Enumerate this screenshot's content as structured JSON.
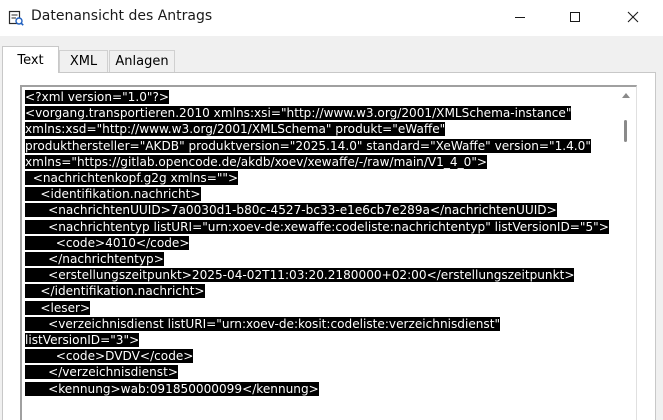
{
  "window": {
    "title": "Datenansicht des Antrags",
    "icon": "document-view-icon"
  },
  "tabs": [
    {
      "label": "Text",
      "active": true
    },
    {
      "label": "XML",
      "active": false
    },
    {
      "label": "Anlagen",
      "active": false
    }
  ],
  "content": {
    "lines": [
      "<?xml version=\"1.0\"?>",
      "<vorgang.transportieren.2010 xmlns:xsi=\"http://www.w3.org/2001/XMLSchema-instance\"",
      "xmlns:xsd=\"http://www.w3.org/2001/XMLSchema\" produkt=\"eWaffe\"",
      "produkthersteller=\"AKDB\" produktversion=\"2025.14.0\" standard=\"XeWaffe\" version=\"1.4.0\"",
      "xmlns=\"https://gitlab.opencode.de/akdb/xoev/xewaffe/-/raw/main/V1_4_0\">",
      "  <nachrichtenkopf.g2g xmlns=\"\">",
      "    <identifikation.nachricht>",
      "      <nachrichtenUUID>7a0030d1-b80c-4527-bc33-e1e6cb7e289a</nachrichtenUUID>",
      "      <nachrichtentyp listURI=\"urn:xoev-de:xewaffe:codeliste:nachrichtentyp\" listVersionID=\"5\">",
      "        <code>4010</code>",
      "      </nachrichtentyp>",
      "      <erstellungszeitpunkt>2025-04-02T11:03:20.2180000+02:00</erstellungszeitpunkt>",
      "    </identifikation.nachricht>",
      "    <leser>",
      "      <verzeichnisdienst listURI=\"urn:xoev-de:kosit:codeliste:verzeichnisdienst\"",
      "listVersionID=\"3\">",
      "        <code>DVDV</code>",
      "      </verzeichnisdienst>",
      "      <kennung>wab:091850000099</kennung>"
    ]
  },
  "colors": {
    "selection_background": "#000000",
    "selection_text": "#ffffff",
    "window_background": "#f0f0f0"
  }
}
